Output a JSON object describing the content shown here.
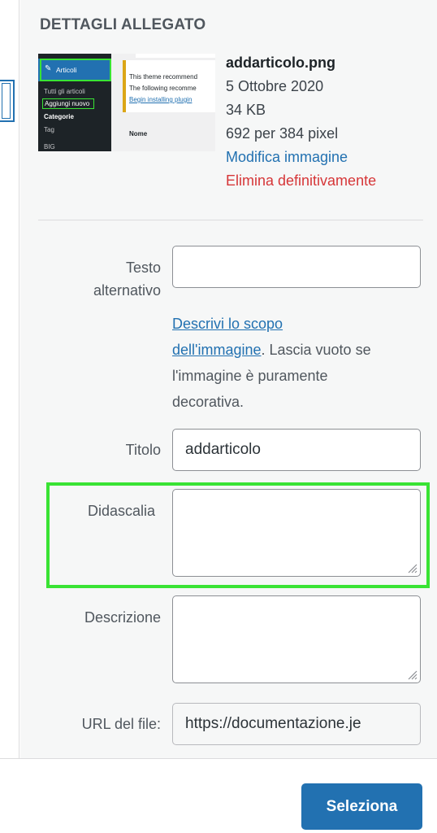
{
  "section_title": "DETTAGLI ALLEGATO",
  "thumbnail": {
    "menu_active": "Articoli",
    "menu_all_posts": "Tutti gli articoli",
    "menu_add_new": "Aggiungi nuovo",
    "menu_categories": "Categorie",
    "menu_tag": "Tag",
    "menu_bottom": "BIG",
    "notice_line1": "This theme recommend",
    "notice_line2": "The following recomme",
    "notice_link": "Begin installing plugin",
    "column_name": "Nome",
    "highlight_color": "#39e334"
  },
  "attachment": {
    "filename": "addarticolo.png",
    "date": "5 Ottobre 2020",
    "size": "34 KB",
    "dimensions": "692 per 384 pixel",
    "edit_link": "Modifica immagine",
    "delete_link": "Elimina definitivamente"
  },
  "fields": {
    "alt_label_line1": "Testo",
    "alt_label_line2": "alternativo",
    "alt_value": "",
    "alt_help_link_part1": "Descrivi lo scopo",
    "alt_help_link_part2": "dell'immagine",
    "alt_help_text_part1": ". Lascia vuoto se",
    "alt_help_text_part2": "l'immagine è puramente",
    "alt_help_text_part3": "decorativa.",
    "title_label": "Titolo",
    "title_value": "addarticolo",
    "caption_label": "Didascalia",
    "caption_value": "",
    "description_label": "Descrizione",
    "description_value": "",
    "url_label": "URL del file:",
    "url_value": "https://documentazione.je"
  },
  "footer": {
    "select_button": "Seleziona"
  },
  "colors": {
    "accent": "#2271b1",
    "danger": "#d63638",
    "highlight": "#39e334"
  }
}
